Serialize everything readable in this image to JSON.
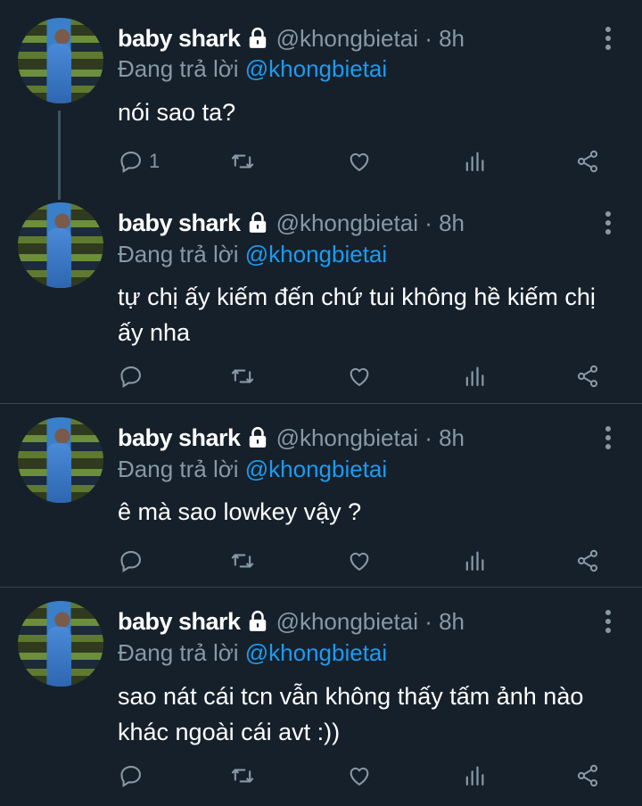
{
  "tweets": [
    {
      "name": "baby shark",
      "handle_time": "@khongbietai · 8h",
      "replying_prefix": "Đang trả lời ",
      "replying_mention": "@khongbietai",
      "text": "nói sao ta?",
      "reply_count": "1"
    },
    {
      "name": "baby shark",
      "handle_time": "@khongbietai · 8h",
      "replying_prefix": "Đang trả lời ",
      "replying_mention": "@khongbietai",
      "text": "tự chị ấy kiếm đến chứ tui không hề kiếm chị ấy nha",
      "reply_count": ""
    },
    {
      "name": "baby shark",
      "handle_time": "@khongbietai · 8h",
      "replying_prefix": "Đang trả lời ",
      "replying_mention": "@khongbietai",
      "text": "ê mà sao lowkey vậy ?",
      "reply_count": ""
    },
    {
      "name": "baby shark",
      "handle_time": "@khongbietai · 8h",
      "replying_prefix": "Đang trả lời ",
      "replying_mention": "@khongbietai",
      "text": "sao nát cái tcn vẫn không thấy tấm ảnh nào khác ngoài cái avt :))",
      "reply_count": ""
    }
  ],
  "colors": {
    "background": "#15202b",
    "muted": "#8899a6",
    "mention": "#1d9bf0",
    "divider": "#38444d"
  },
  "icons": [
    "lock-icon",
    "more-options-icon",
    "reply-icon",
    "retweet-icon",
    "like-icon",
    "analytics-icon",
    "share-icon"
  ]
}
